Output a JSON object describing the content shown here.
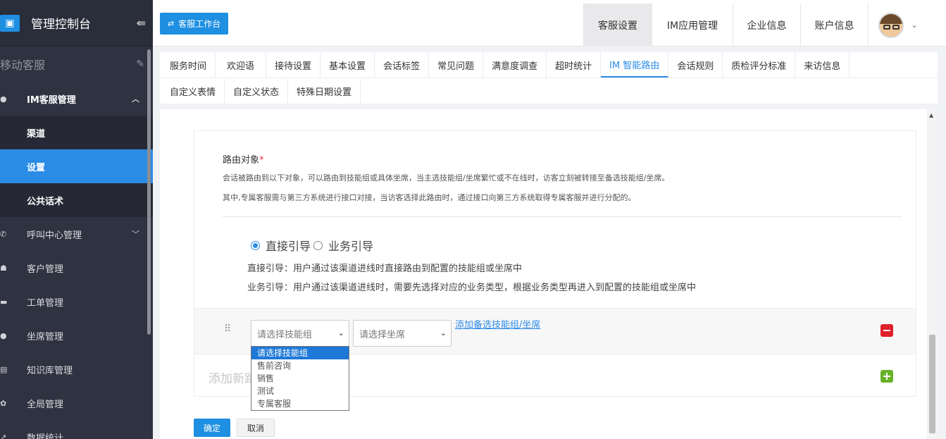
{
  "sidebar": {
    "brand": "管理控制台",
    "section": "移动客服",
    "items": [
      {
        "label": "IM客服管理",
        "icon": "chat-icon",
        "arrow": "^"
      },
      {
        "label": "呼叫中心管理",
        "icon": "phone-icon",
        "arrow": "v"
      },
      {
        "label": "客户管理",
        "icon": "users-icon"
      },
      {
        "label": "工单管理",
        "icon": "ticket-icon"
      },
      {
        "label": "坐席管理",
        "icon": "agent-icon"
      },
      {
        "label": "知识库管理",
        "icon": "book-icon"
      },
      {
        "label": "全局管理",
        "icon": "gear-icon"
      },
      {
        "label": "数据统计",
        "icon": "chart-icon"
      }
    ],
    "children": [
      {
        "label": "渠道"
      },
      {
        "label": "设置"
      },
      {
        "label": "公共话术"
      }
    ]
  },
  "topbar": {
    "workspace_button": "客服工作台",
    "tabs": [
      "客服设置",
      "IM应用管理",
      "企业信息",
      "账户信息"
    ]
  },
  "settings_tabs": {
    "row1": [
      "服务时间",
      "欢迎语",
      "接待设置",
      "基本设置",
      "会话标签",
      "常见问题",
      "满意度调查",
      "超时统计",
      "IM 智能路由",
      "会话规则",
      "质检评分标准",
      "来访信息"
    ],
    "row2": [
      "自定义表情",
      "自定义状态",
      "特殊日期设置"
    ],
    "active": "IM 智能路由"
  },
  "routing": {
    "title": "路由对象",
    "required_mark": "*",
    "desc1": "会话被路由到以下对象，可以路由到技能组或具体坐席，当主选技能组/坐席繁忙或不在线时，访客立刻被转接至备选技能组/坐席。",
    "desc2": "其中,专属客服需与第三方系统进行接口对接，当访客选择此路由时，通过接口向第三方系统取得专属客服并进行分配的。",
    "radio_direct": "直接引导",
    "radio_business": "业务引导",
    "direct_desc": "直接引导：用户通过该渠道进线时直接路由到配置的技能组或坐席中",
    "business_desc": "业务引导：用户通过该渠道进线时，需要先选择对应的业务类型，根据业务类型再进入到配置的技能组或坐席中",
    "skill_select_placeholder": "请选择技能组",
    "agent_select_placeholder": "请选择坐席",
    "add_alternate": "添加备选技能组/坐席",
    "add_new": "添加新路",
    "skill_options": [
      "请选择技能组",
      "售前咨询",
      "销售",
      "测试",
      "专属客服"
    ]
  },
  "actions": {
    "confirm": "确定",
    "cancel": "取消"
  }
}
